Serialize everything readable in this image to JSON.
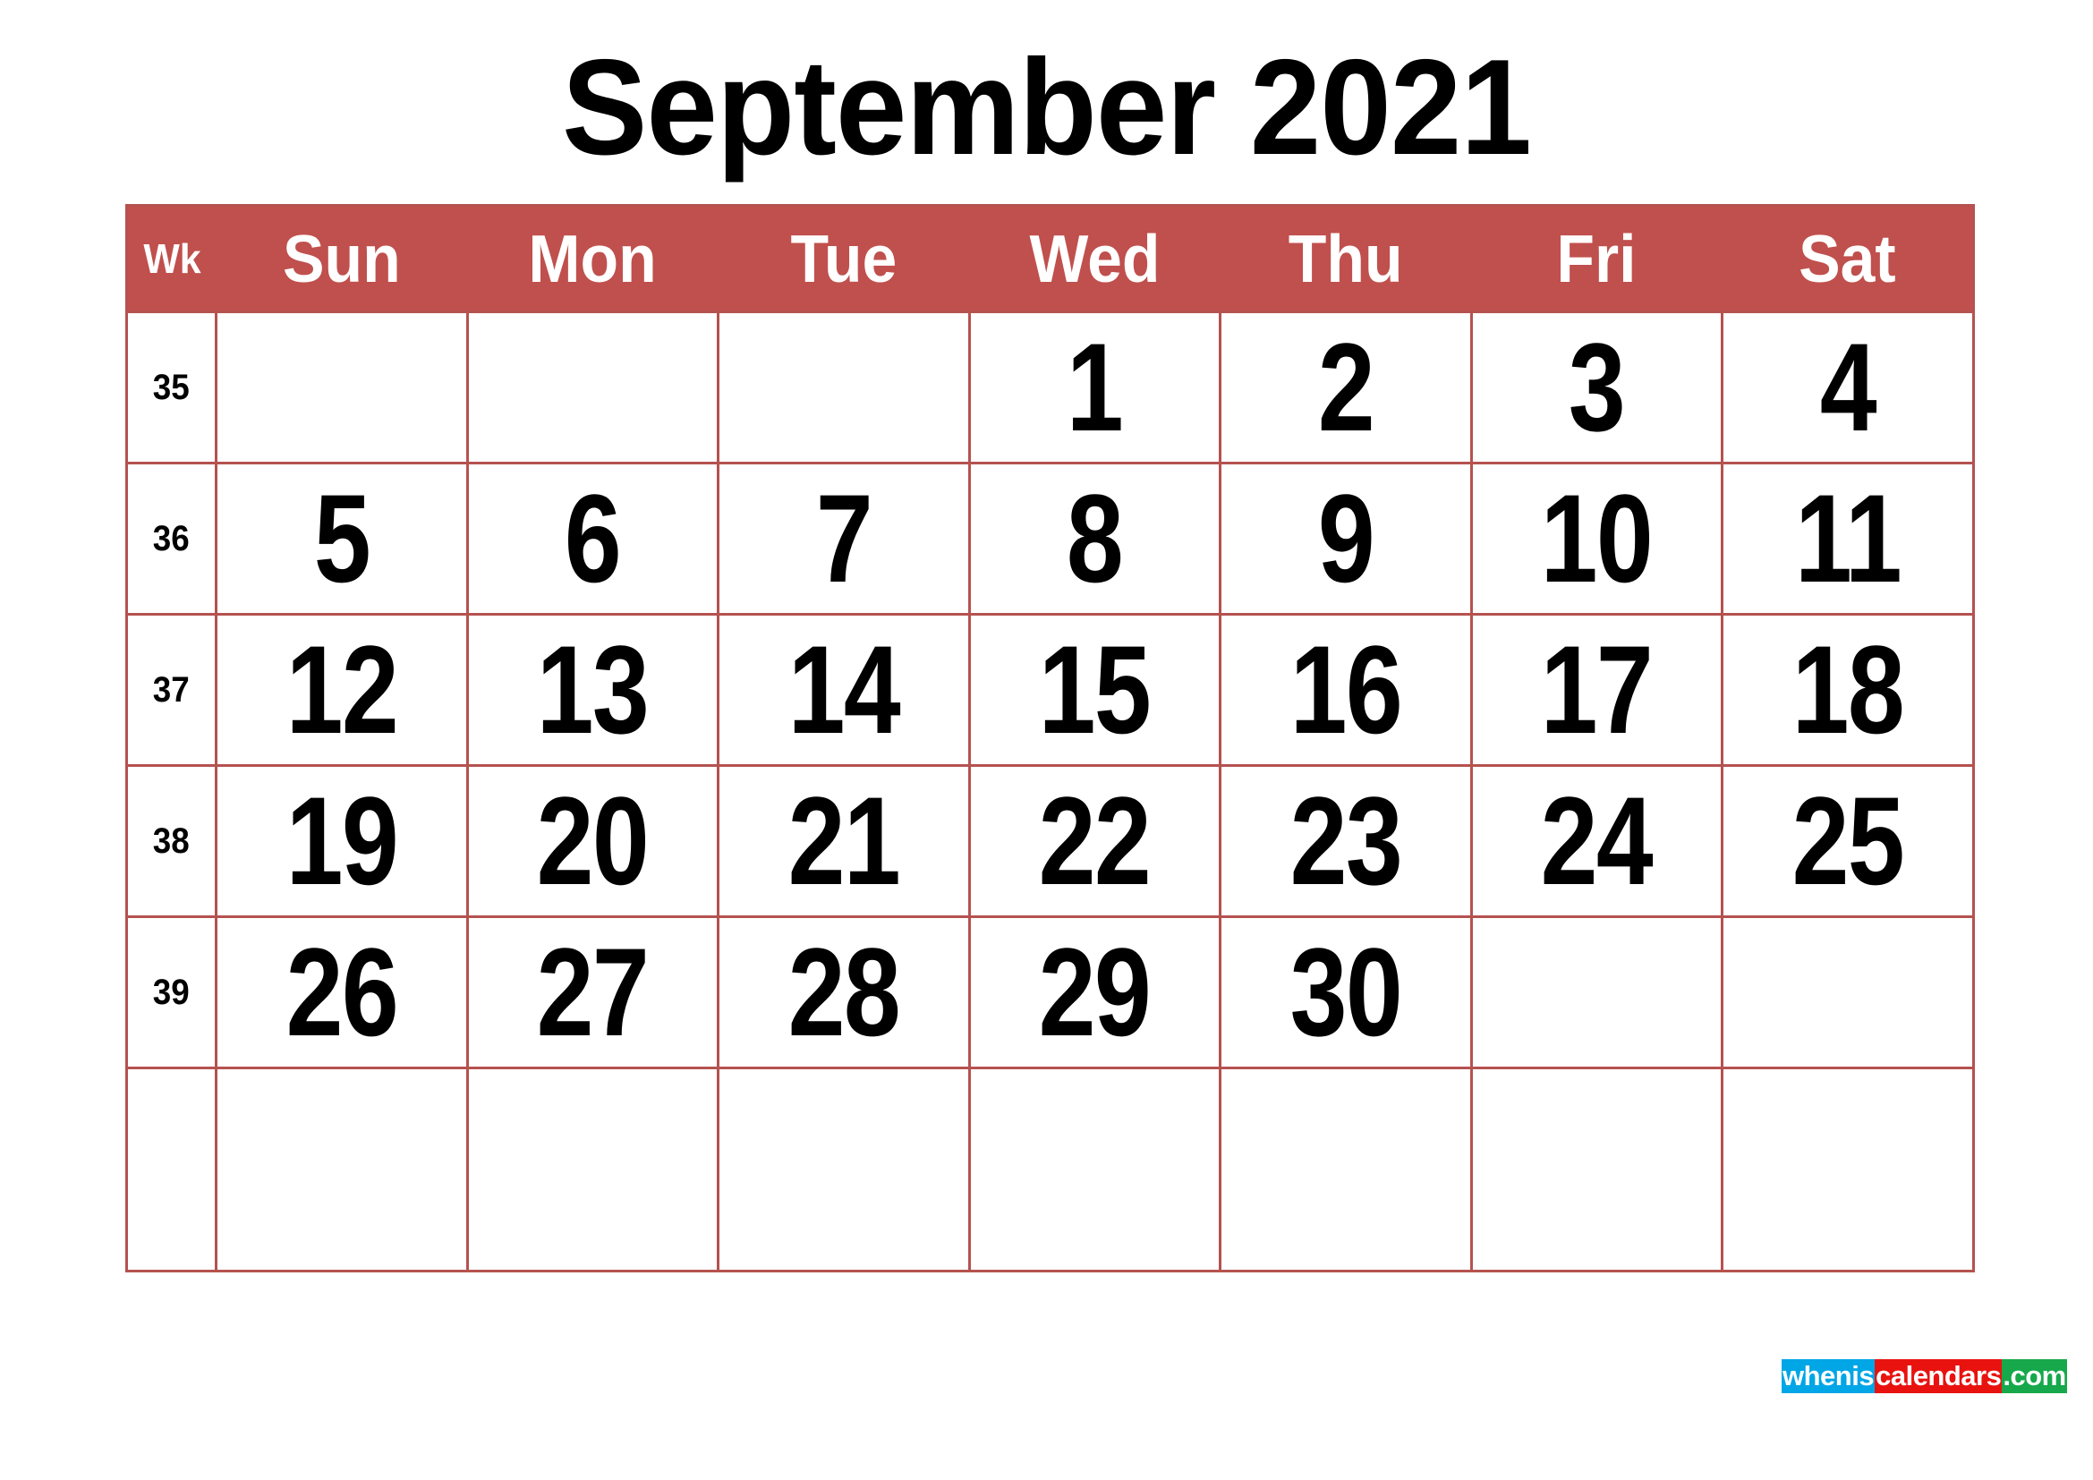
{
  "page": {
    "title": "September 2021",
    "month": "September",
    "year": "2021",
    "background_color": "#ffffff"
  },
  "colors": {
    "header_bar": "#c0504d",
    "grid_line": "#b5524f",
    "text": "#000000",
    "header_text": "#ffffff",
    "watermark_blue": "#00a6e6",
    "watermark_red": "#e8130f",
    "watermark_green": "#16a84a"
  },
  "calendar": {
    "week_column_header": "Wk",
    "day_headers": [
      "Sun",
      "Mon",
      "Tue",
      "Wed",
      "Thu",
      "Fri",
      "Sat"
    ],
    "rows": [
      {
        "week": "35",
        "days": [
          "",
          "",
          "",
          "1",
          "2",
          "3",
          "4"
        ]
      },
      {
        "week": "36",
        "days": [
          "5",
          "6",
          "7",
          "8",
          "9",
          "10",
          "11"
        ]
      },
      {
        "week": "37",
        "days": [
          "12",
          "13",
          "14",
          "15",
          "16",
          "17",
          "18"
        ]
      },
      {
        "week": "38",
        "days": [
          "19",
          "20",
          "21",
          "22",
          "23",
          "24",
          "25"
        ]
      },
      {
        "week": "39",
        "days": [
          "26",
          "27",
          "28",
          "29",
          "30",
          "",
          ""
        ]
      },
      {
        "week": "",
        "days": [
          "",
          "",
          "",
          "",
          "",
          "",
          ""
        ]
      }
    ]
  },
  "watermark": {
    "part1": "whenis",
    "part2": "calendars",
    "part3": ".com"
  }
}
